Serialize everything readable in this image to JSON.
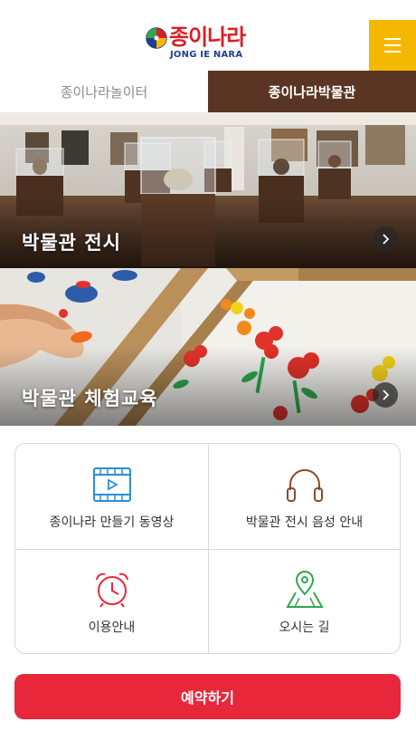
{
  "header": {
    "logo_text": "종이나라",
    "logo_sub": "JONG IE NARA",
    "menu_icon": "hamburger-icon"
  },
  "tabs": [
    {
      "label": "종이나라놀이터",
      "active": false
    },
    {
      "label": "종이나라박물관",
      "active": true
    }
  ],
  "banners": [
    {
      "title": "박물관 전시",
      "arrow_icon": "chevron-right-icon"
    },
    {
      "title": "박물관 체험교육",
      "arrow_icon": "chevron-right-icon"
    }
  ],
  "menu_grid": [
    {
      "label": "종이나라 만들기 동영상",
      "icon": "video-icon",
      "color": "#2b8fd6"
    },
    {
      "label": "박물관 전시 음성 안내",
      "icon": "headphones-icon",
      "color": "#8a4b2a"
    },
    {
      "label": "이용안내",
      "icon": "alarm-clock-icon",
      "color": "#e8283a"
    },
    {
      "label": "오시는 길",
      "icon": "map-pin-icon",
      "color": "#2fa84f"
    }
  ],
  "reserve_button": {
    "label": "예약하기"
  },
  "colors": {
    "accent_red": "#e8283a",
    "tab_active_bg": "#5a3523",
    "menu_yellow": "#f5b800"
  }
}
